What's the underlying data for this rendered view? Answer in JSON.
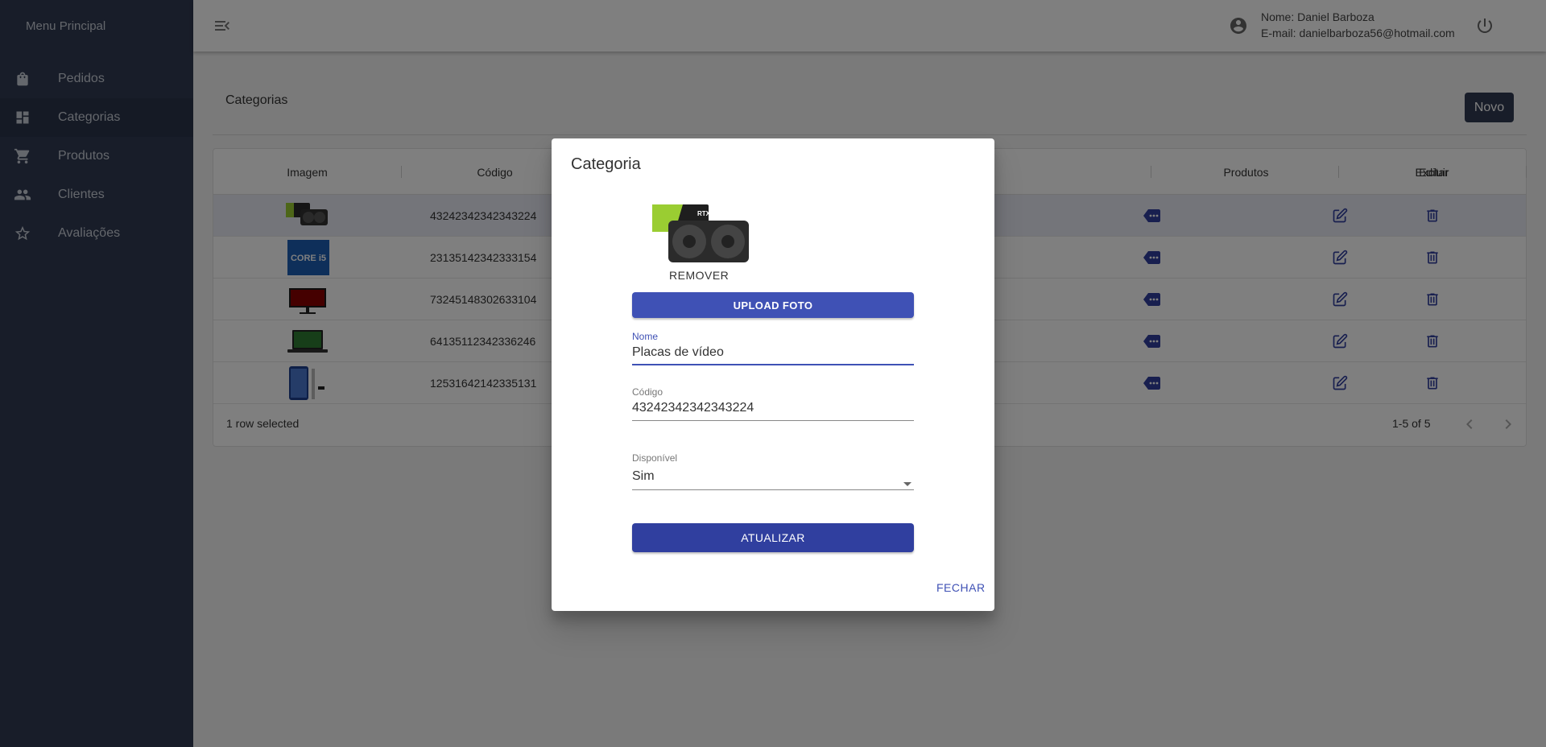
{
  "sidebar": {
    "title": "Menu Principal",
    "items": [
      {
        "label": "Pedidos",
        "icon": "shopping-bag-icon"
      },
      {
        "label": "Categorias",
        "icon": "dashboard-icon"
      },
      {
        "label": "Produtos",
        "icon": "shopping-cart-icon"
      },
      {
        "label": "Clientes",
        "icon": "people-icon"
      },
      {
        "label": "Avaliações",
        "icon": "star-outline-icon"
      }
    ]
  },
  "topbar": {
    "user_name": "Nome: Daniel Barboza",
    "user_email": "E-mail: danielbarboza56@hotmail.com"
  },
  "page": {
    "title": "Categorias",
    "new_button": "Novo"
  },
  "table": {
    "columns": {
      "imagem": "Imagem",
      "codigo": "Código",
      "produtos": "Produtos",
      "editar": "Editar",
      "excluir": "Excluir"
    },
    "rows": [
      {
        "codigo": "43242342342343224",
        "image": "graphics-card-thumb"
      },
      {
        "codigo": "23135142342333154",
        "image": "processor-box-thumb"
      },
      {
        "codigo": "73245148302633104",
        "image": "monitor-thumb"
      },
      {
        "codigo": "64135112342336246",
        "image": "laptop-thumb"
      },
      {
        "codigo": "12531642142335131",
        "image": "smartphone-thumb"
      }
    ],
    "footer": {
      "selected": "1 row selected",
      "pagination": "1-5 of 5"
    }
  },
  "dialog": {
    "title": "Categoria",
    "remove_label": "REMOVER",
    "upload_label": "UPLOAD FOTO",
    "nome_label": "Nome",
    "nome_value": "Placas de vídeo",
    "codigo_label": "Código",
    "codigo_value": "43242342342343224",
    "disponivel_label": "Disponível",
    "disponivel_value": "Sim",
    "update_label": "ATUALIZAR",
    "close_label": "FECHAR"
  },
  "colors": {
    "sidebar": "#303a52",
    "primary": "#3f51b5",
    "primary_dark": "#303f9f",
    "accent_icon": "#303f9f"
  }
}
